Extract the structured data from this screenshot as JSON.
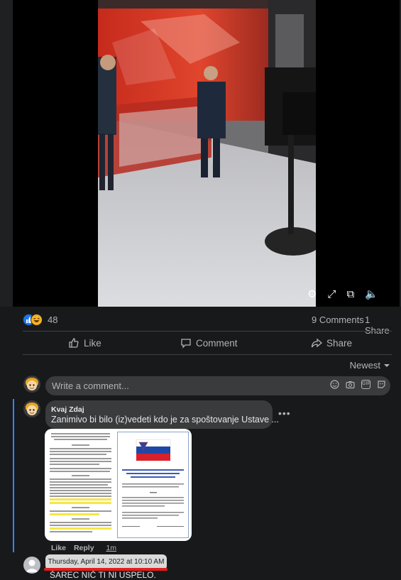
{
  "video": {
    "controls": [
      {
        "name": "settings-icon",
        "glyph": "⚙"
      },
      {
        "name": "expand-icon",
        "glyph": "⤢"
      },
      {
        "name": "picture-in-picture-icon",
        "glyph": "⧉"
      },
      {
        "name": "mute-icon",
        "glyph": "🔈"
      }
    ]
  },
  "stats": {
    "reaction_icons": [
      "like-reaction-icon",
      "haha-reaction-icon"
    ],
    "reaction_count": "48",
    "comments": "9 Comments",
    "shares": "1 Share"
  },
  "actions": {
    "like": "Like",
    "comment": "Comment",
    "share": "Share"
  },
  "sort": {
    "label": "Newest"
  },
  "composer": {
    "placeholder": "Write a comment..."
  },
  "comment": {
    "author": "Kvaj Zdaj",
    "text": "Zanimivo bi bilo (iz)vedeti kdo je za spoštovanje Ustave ...",
    "like": "Like",
    "reply": "Reply",
    "time": "1m"
  },
  "tooltip": {
    "text": "Thursday, April 14, 2022 at 10:10 AM"
  },
  "reply": {
    "text": "ŠAREC NIČ TI NI USPELO."
  },
  "colors": {
    "background": "#18191a",
    "surface": "#3a3b3c",
    "accent": "#2d88ff",
    "annotation_red": "#e0201e"
  }
}
